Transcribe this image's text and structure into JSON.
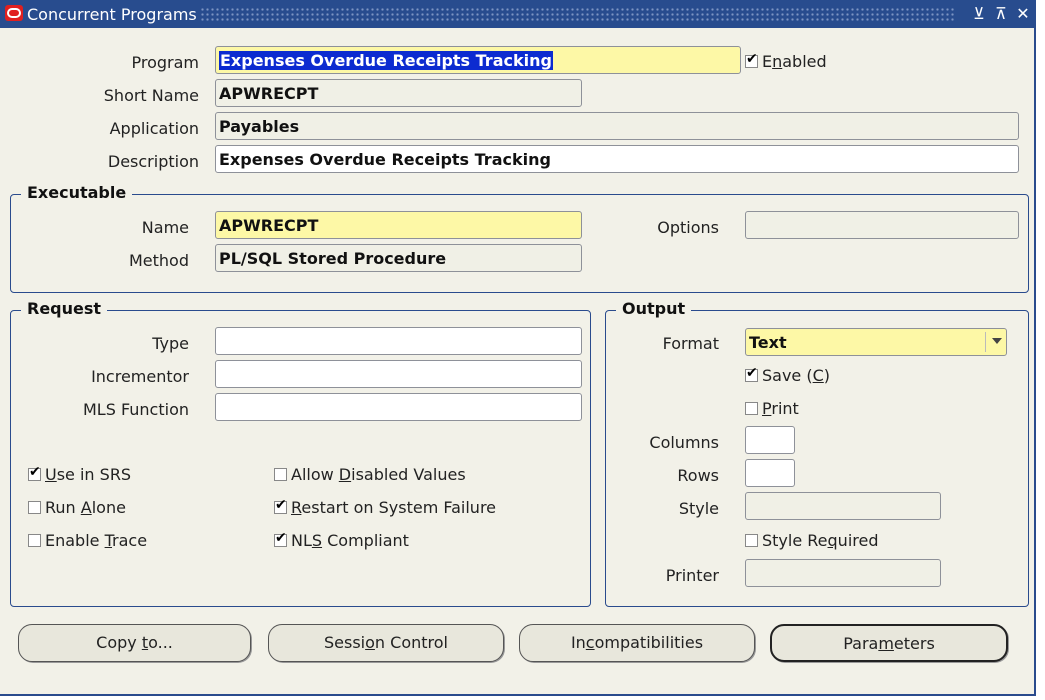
{
  "window": {
    "title": "Concurrent Programs",
    "minimize_glyph": "⊻",
    "maximize_glyph": "⊼",
    "close_glyph": "✕"
  },
  "header": {
    "program_label": "Program",
    "program_value": "Expenses Overdue Receipts Tracking",
    "enabled_label": "Enabled",
    "enabled_checked": true,
    "short_name_label": "Short Name",
    "short_name_value": "APWRECPT",
    "application_label": "Application",
    "application_value": "Payables",
    "description_label": "Description",
    "description_value": "Expenses Overdue Receipts Tracking"
  },
  "executable": {
    "title": "Executable",
    "name_label": "Name",
    "name_value": "APWRECPT",
    "method_label": "Method",
    "method_value": "PL/SQL Stored Procedure",
    "options_label": "Options",
    "options_value": ""
  },
  "request": {
    "title": "Request",
    "type_label": "Type",
    "type_value": "",
    "incrementor_label": "Incrementor",
    "incrementor_value": "",
    "mls_label": "MLS Function",
    "mls_value": "",
    "checkboxes": [
      {
        "label": "Use in SRS",
        "checked": true
      },
      {
        "label": "Run Alone",
        "checked": false
      },
      {
        "label": "Enable Trace",
        "checked": false
      },
      {
        "label": "Allow Disabled Values",
        "checked": false
      },
      {
        "label": "Restart on System Failure",
        "checked": true
      },
      {
        "label": "NLS Compliant",
        "checked": true
      }
    ]
  },
  "output": {
    "title": "Output",
    "format_label": "Format",
    "format_value": "Text",
    "save_label": "Save (C)",
    "save_checked": true,
    "print_label": "Print",
    "print_checked": false,
    "columns_label": "Columns",
    "columns_value": "",
    "rows_label": "Rows",
    "rows_value": "",
    "style_label": "Style",
    "style_value": "",
    "style_required_label": "Style Required",
    "style_required_checked": false,
    "printer_label": "Printer",
    "printer_value": ""
  },
  "buttons": {
    "copy_to": "Copy to...",
    "session_control": "Session Control",
    "incompatibilities": "Incompatibilities",
    "parameters": "Parameters"
  },
  "colors": {
    "titlebar": "#284c8e",
    "required_field": "#fdf8a6",
    "selection": "#0c2bd0",
    "background": "#f2f1e8"
  }
}
